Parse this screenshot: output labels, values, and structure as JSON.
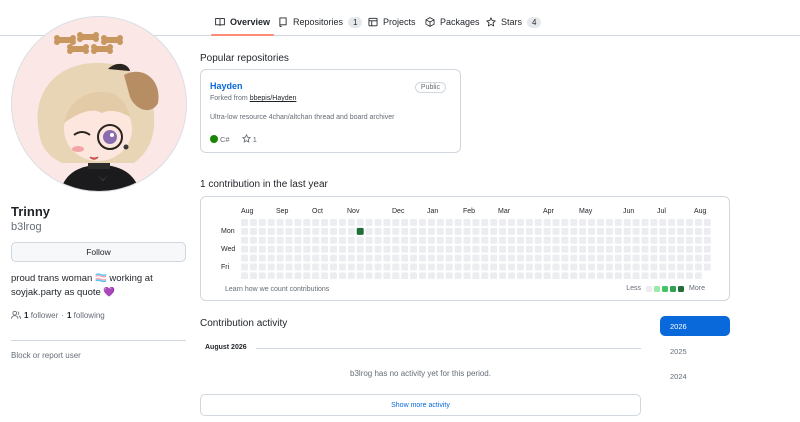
{
  "tabs": [
    {
      "label": "Overview",
      "count": null,
      "icon": "book-icon"
    },
    {
      "label": "Repositories",
      "count": "1",
      "icon": "repo-icon"
    },
    {
      "label": "Projects",
      "count": null,
      "icon": "table-icon"
    },
    {
      "label": "Packages",
      "count": null,
      "icon": "package-icon"
    },
    {
      "label": "Stars",
      "count": "4",
      "icon": "star-icon"
    }
  ],
  "profile": {
    "name": "Trinny",
    "login": "b3lrog",
    "follow_label": "Follow",
    "bio_text": "proud trans woman 🏳️‍⚧️ working at soyjak.party as quote",
    "bio_heart": "💜",
    "followers_count": "1",
    "followers_label": "follower",
    "following_count": "1",
    "following_label": "following",
    "block_label": "Block or report user"
  },
  "popular": {
    "title": "Popular repositories",
    "repo": {
      "name": "Hayden",
      "visibility": "Public",
      "forked_prefix": "Forked from",
      "forked_from": "bbepis/Hayden",
      "description": "Ultra-low resource 4chan/altchan thread and board archiver",
      "language": "C#",
      "language_color": "#178600",
      "stars": "1"
    }
  },
  "contributions": {
    "title": "1 contribution in the last year",
    "months": [
      "Aug",
      "Sep",
      "Oct",
      "Nov",
      "Dec",
      "Jan",
      "Feb",
      "Mar",
      "Apr",
      "May",
      "Jun",
      "Jul",
      "Aug"
    ],
    "day_labels": [
      "Mon",
      "Wed",
      "Fri"
    ],
    "weeks": 53,
    "active_week": 13,
    "active_day": 1,
    "learn_label": "Learn how we count contributions",
    "legend_less": "Less",
    "legend_more": "More",
    "legend_colors": [
      "#ebedf0",
      "#9be9a8",
      "#40c463",
      "#30a14e",
      "#216e39"
    ],
    "empty_color": "#ebedf0",
    "active_color": "#216e39"
  },
  "activity": {
    "title": "Contribution activity",
    "period": "August 2026",
    "empty_text": "b3lrog has no activity yet for this period.",
    "more_label": "Show more activity",
    "years": [
      "2026",
      "2025",
      "2024"
    ],
    "selected_year": "2026"
  }
}
